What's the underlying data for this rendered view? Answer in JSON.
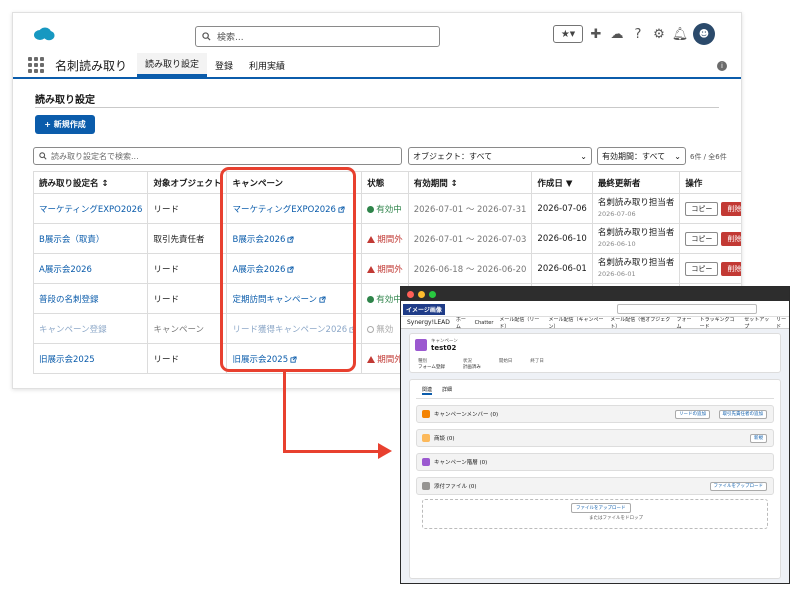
{
  "header": {
    "search_placeholder": "検索...",
    "avatar": "☻"
  },
  "nav": {
    "app_name": "名刺読み取り",
    "tabs": [
      {
        "label": "読み取り設定",
        "active": true
      },
      {
        "label": "登録",
        "active": false
      },
      {
        "label": "利用実績",
        "active": false
      }
    ]
  },
  "page": {
    "title": "読み取り設定",
    "new_button": "+ 新規作成",
    "filter_search_placeholder": "読み取り設定名で検索...",
    "object_filter": "オブジェクト：すべて",
    "period_filter": "有効期間：すべて",
    "count": "6件 / 全6件"
  },
  "table": {
    "headers": [
      "読み取り設定名 ↕",
      "対象オブジェクト",
      "キャンペーン",
      "状態",
      "有効期間 ↕",
      "作成日 ▼",
      "最終更新者",
      "操作"
    ],
    "rows": [
      {
        "name": "マーケティングEXPO2026",
        "object": "リード",
        "campaign": "マーケティングEXPO2026",
        "status": "有効中",
        "status_type": "ok",
        "period": "2026-07-01 〜 2026-07-31",
        "created": "2026-07-06",
        "updater": "名刺読み取り担当者",
        "updated": "2026-07-06",
        "copy": "コピー",
        "delete": "削除"
      },
      {
        "name": "B展示会（取責）",
        "object": "取引先責任者",
        "campaign": "B展示会2026",
        "status": "期間外",
        "status_type": "ng",
        "period": "2026-07-01 〜 2026-07-03",
        "created": "2026-06-10",
        "updater": "名刺読み取り担当者",
        "updated": "2026-06-10",
        "copy": "コピー",
        "delete": "削除"
      },
      {
        "name": "A展示会2026",
        "object": "リード",
        "campaign": "A展示会2026",
        "status": "期間外",
        "status_type": "ng",
        "period": "2026-06-18 〜 2026-06-20",
        "created": "2026-06-01",
        "updater": "名刺読み取り担当者",
        "updated": "2026-06-01",
        "copy": "コピー",
        "delete": "削除"
      },
      {
        "name": "普段の名刺登録",
        "object": "リード",
        "campaign": "定期訪問キャンペーン",
        "status": "有効中",
        "status_type": "ok",
        "period": "",
        "created": "",
        "updater": "",
        "updated": "",
        "copy": "",
        "delete": ""
      },
      {
        "name": "キャンペーン登録",
        "object": "キャンペーン",
        "campaign": "リード獲得キャンペーン2026",
        "status": "無効",
        "status_type": "off",
        "period": "",
        "created": "",
        "updater": "",
        "updated": "",
        "copy": "",
        "delete": ""
      },
      {
        "name": "旧展示会2025",
        "object": "リード",
        "campaign": "旧展示会2025",
        "status": "期間外",
        "status_type": "ng",
        "period": "",
        "created": "",
        "updater": "",
        "updated": "",
        "copy": "",
        "delete": ""
      }
    ]
  },
  "popup": {
    "tag": "イメージ画像",
    "app_name": "Synergy!LEAD",
    "nav": [
      "ホーム",
      "Chatter",
      "メール配信（リード）",
      "メール配信（キャンペーン）",
      "メール配信（他オブジェクト）",
      "フォーム",
      "トラッキングコード",
      "セットアップ",
      "リード"
    ],
    "object_label": "キャンペーン",
    "record_name": "test02",
    "fields": [
      {
        "label": "種別",
        "value": "フォーム登録"
      },
      {
        "label": "状況",
        "value": "計画済み"
      },
      {
        "label": "開始日",
        "value": ""
      },
      {
        "label": "終了日",
        "value": ""
      }
    ],
    "tabs": [
      "関連",
      "詳細"
    ],
    "cards": [
      {
        "label": "キャンペーンメンバー (0)",
        "color": "#f38303",
        "buttons": [
          "リードの追加",
          "取引先責任者の追加"
        ]
      },
      {
        "label": "商談 (0)",
        "color": "#fcb95b",
        "buttons": [
          "新規"
        ]
      },
      {
        "label": "キャンペーン階層 (0)",
        "color": "#9b59d0",
        "buttons": []
      },
      {
        "label": "添付ファイル (0)",
        "color": "#969492",
        "buttons": [
          "ファイルをアップロード"
        ]
      }
    ],
    "upload_button": "ファイルをアップロード",
    "drop_text": "またはファイルをドロップ"
  },
  "colors": {
    "brand": "#0b5cab",
    "highlight": "#e8402f",
    "danger": "#c23934",
    "success": "#2e844a"
  }
}
